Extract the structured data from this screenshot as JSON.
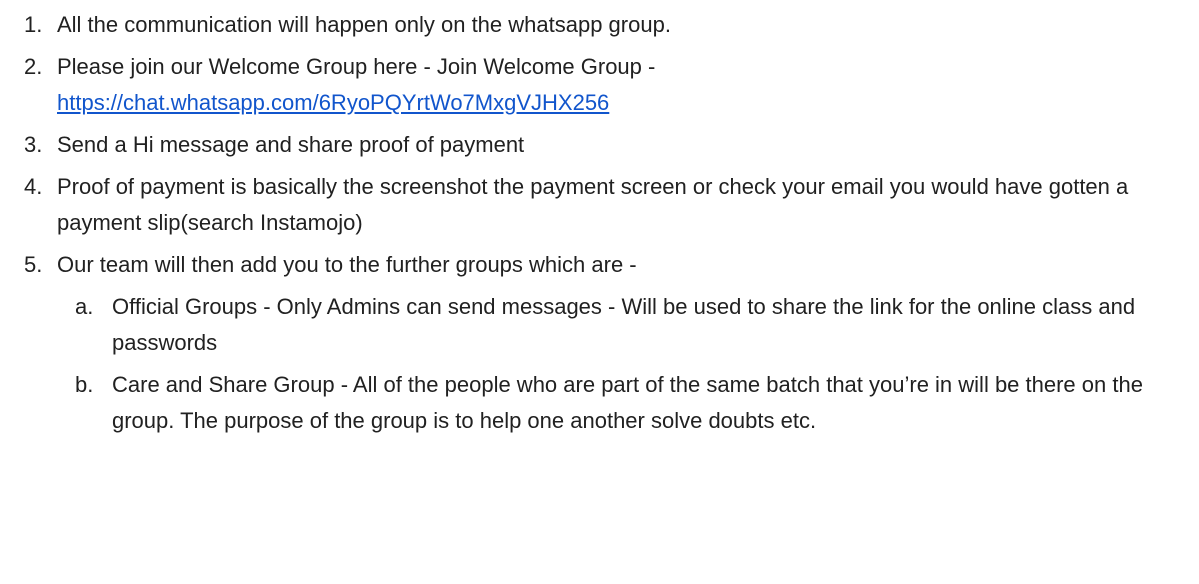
{
  "items": [
    {
      "marker": "1.",
      "text": "All the communication will happen only on the whatsapp group."
    },
    {
      "marker": "2.",
      "text": "Please join our Welcome Group here - Join Welcome Group -",
      "link": "https://chat.whatsapp.com/6RyoPQYrtWo7MxgVJHX256"
    },
    {
      "marker": "3.",
      "text": "Send a Hi message and share proof of payment"
    },
    {
      "marker": "4.",
      "text": "Proof of payment is basically the screenshot the payment screen or check your email you would have gotten a payment slip(search Instamojo)"
    },
    {
      "marker": "5.",
      "text": "Our team will then add you to the further groups which are -"
    }
  ],
  "subitems": [
    {
      "marker": "a.",
      "text": "Official Groups - Only Admins can send messages - Will be used to share the link for the online class and passwords"
    },
    {
      "marker": "b.",
      "text": "Care and Share Group - All of the people who are part of the same batch that you’re in will be there on the group. The purpose of the group is to help one another solve doubts etc."
    }
  ],
  "colors": {
    "text": "#212121",
    "link": "#1155cc",
    "background": "#ffffff"
  }
}
